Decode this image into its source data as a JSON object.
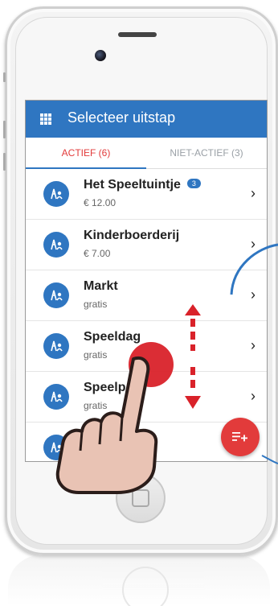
{
  "appbar": {
    "title": "Selecteer uitstap",
    "menu_icon": "apps-grid-icon"
  },
  "tabs": [
    {
      "label": "ACTIEF (6)",
      "active": true
    },
    {
      "label": "NIET-ACTIEF (3)",
      "active": false
    }
  ],
  "items": [
    {
      "title": "Het Speeltuintje",
      "subtitle": "€ 12.00",
      "badge": "3"
    },
    {
      "title": "Kinderboerderij",
      "subtitle": "€ 7.00"
    },
    {
      "title": "Markt",
      "subtitle": "gratis"
    },
    {
      "title": "Speeldag",
      "subtitle": "gratis"
    },
    {
      "title": "Speelp",
      "subtitle": "gratis"
    },
    {
      "title": "",
      "subtitle": ""
    }
  ],
  "fab": {
    "icon": "playlist-add-icon"
  },
  "colors": {
    "primary": "#2f76c1",
    "accent": "#e23b3b"
  }
}
